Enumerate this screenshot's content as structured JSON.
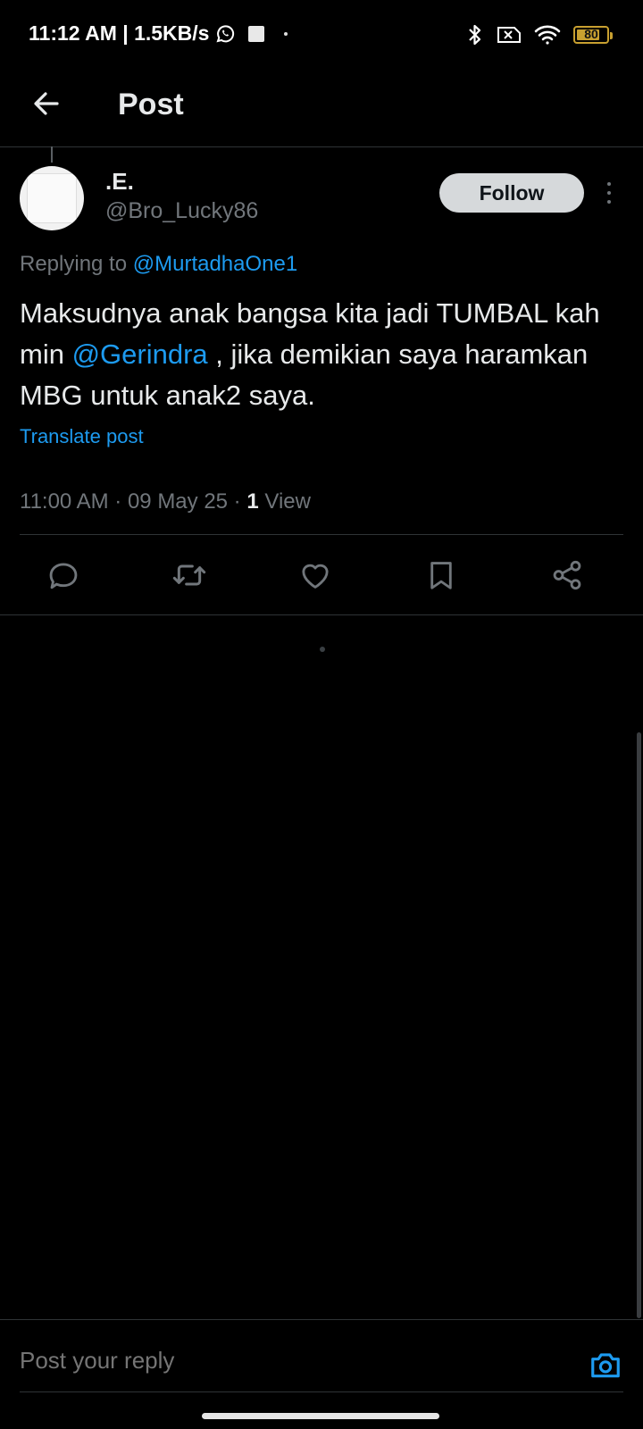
{
  "status_bar": {
    "time_speed": "11:12 AM | 1.5KB/s",
    "icons": [
      "whatsapp-icon",
      "stop-icon",
      "bluetooth-icon",
      "sim-off-icon",
      "wifi-icon"
    ],
    "battery_level": "80",
    "battery_color": "#c8a030"
  },
  "header": {
    "title": "Post",
    "back_icon": "arrow-left-icon"
  },
  "post": {
    "display_name": ".E.",
    "handle": "@Bro_Lucky86",
    "follow_label": "Follow",
    "replying_prefix": "Replying to",
    "replying_to": "@MurtadhaOne1",
    "text_part1": "Maksudnya anak bangsa kita jadi TUMBAL kah min",
    "text_mention": "@Gerindra",
    "text_part2": ", jika demikian saya haramkan MBG untuk anak2 saya.",
    "translate_label": "Translate post",
    "timestamp": "11:00 AM · 09 May 25 · ",
    "views_count": "1",
    "views_label": " View"
  },
  "actions": [
    "reply-icon",
    "repost-icon",
    "like-icon",
    "bookmark-icon",
    "share-icon"
  ],
  "reply_bar": {
    "placeholder": "Post your reply",
    "camera_icon": "camera-icon"
  },
  "colors": {
    "accent": "#1d9bf0",
    "background": "#000000",
    "muted_text": "#71767b",
    "primary_text": "#e7e9ea"
  }
}
